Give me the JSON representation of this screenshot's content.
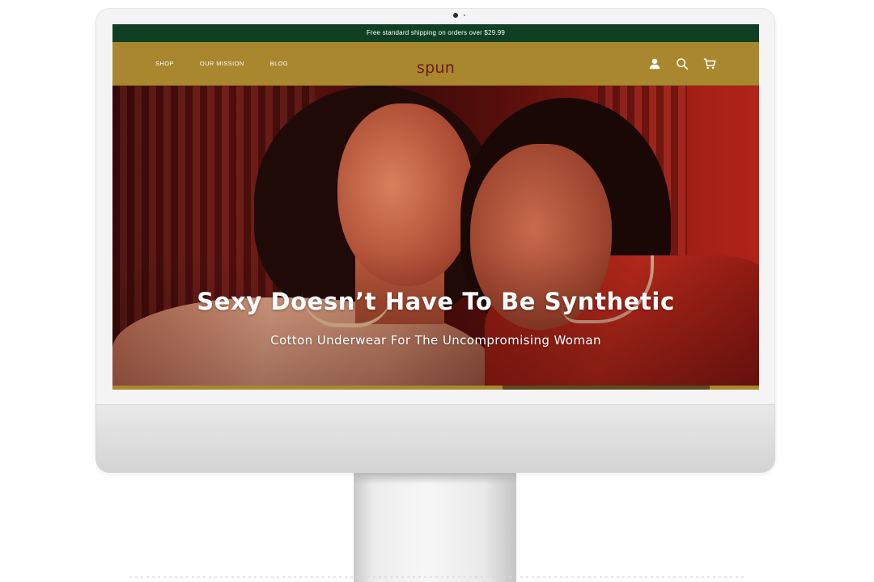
{
  "site": {
    "announcement": "Free standard shipping on orders over $29.99",
    "brand": "spun",
    "nav": [
      {
        "label": "SHOP"
      },
      {
        "label": "OUR MISSION"
      },
      {
        "label": "BLOG"
      }
    ],
    "icons": [
      "account-icon",
      "search-icon",
      "cart-icon"
    ]
  },
  "hero": {
    "headline": "Sexy Doesn’t Have To Be Synthetic",
    "subline": "Cotton Underwear For The Uncompromising Woman"
  },
  "colors": {
    "announcement_bg": "#0f4023",
    "nav_bg": "#a8872f",
    "logo": "#6e1a12"
  }
}
